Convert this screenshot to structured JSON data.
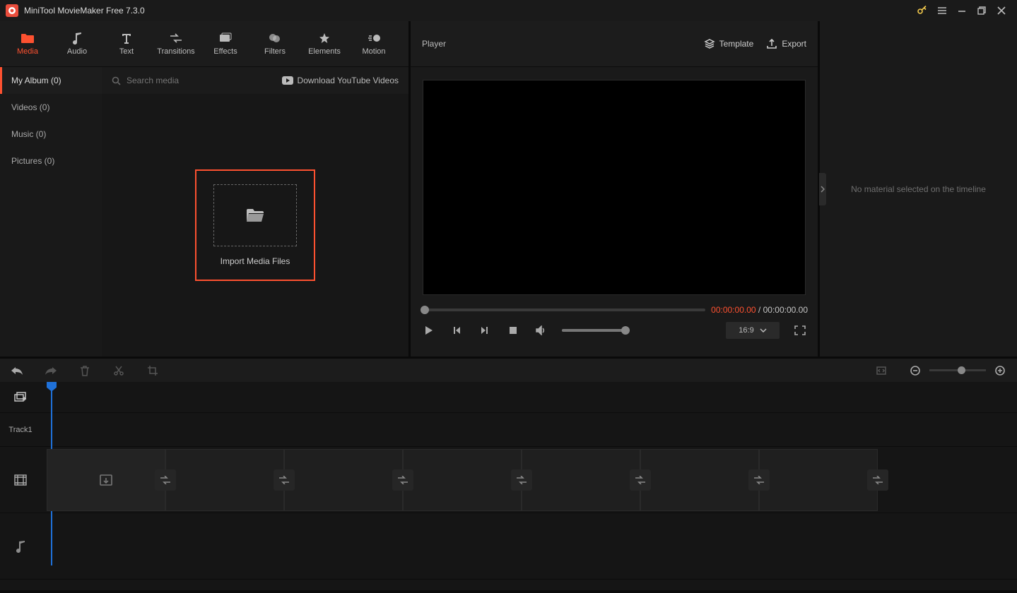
{
  "titlebar": {
    "title": "MiniTool MovieMaker Free 7.3.0"
  },
  "ribbon": [
    {
      "key": "media",
      "label": "Media",
      "active": true
    },
    {
      "key": "audio",
      "label": "Audio"
    },
    {
      "key": "text",
      "label": "Text"
    },
    {
      "key": "transitions",
      "label": "Transitions"
    },
    {
      "key": "effects",
      "label": "Effects"
    },
    {
      "key": "filters",
      "label": "Filters"
    },
    {
      "key": "elements",
      "label": "Elements"
    },
    {
      "key": "motion",
      "label": "Motion"
    }
  ],
  "media_sidebar": [
    {
      "label": "My Album (0)",
      "active": true
    },
    {
      "label": "Videos (0)"
    },
    {
      "label": "Music (0)"
    },
    {
      "label": "Pictures (0)"
    }
  ],
  "media_toolbar": {
    "search_placeholder": "Search media",
    "download_label": "Download YouTube Videos"
  },
  "import_box": {
    "label": "Import Media Files"
  },
  "player": {
    "title": "Player",
    "template_label": "Template",
    "export_label": "Export",
    "current_time": "00:00:00.00",
    "separator": "/",
    "total_time": "00:00:00.00",
    "aspect": "16:9"
  },
  "inspector": {
    "placeholder": "No material selected on the timeline"
  },
  "timeline": {
    "track_label": "Track1"
  }
}
